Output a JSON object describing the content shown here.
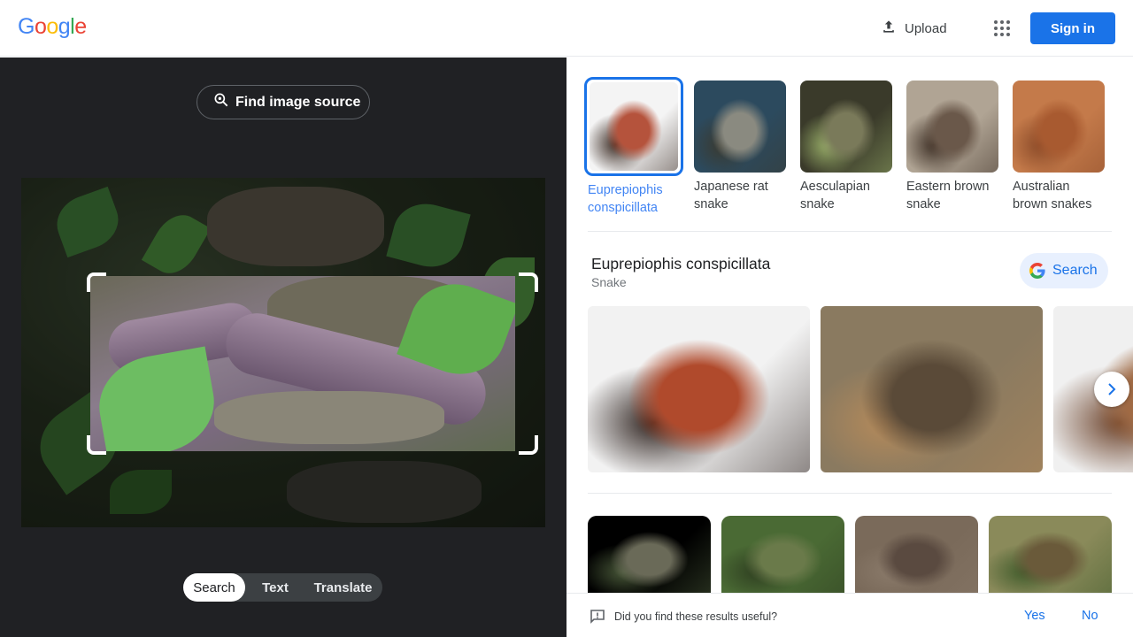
{
  "header": {
    "logo_letters": [
      {
        "ch": "G",
        "color": "#4285F4"
      },
      {
        "ch": "o",
        "color": "#EA4335"
      },
      {
        "ch": "o",
        "color": "#FBBC05"
      },
      {
        "ch": "g",
        "color": "#4285F4"
      },
      {
        "ch": "l",
        "color": "#34A853"
      },
      {
        "ch": "e",
        "color": "#EA4335"
      }
    ],
    "upload_label": "Upload",
    "apps_icon": "grid-apps-icon",
    "signin_label": "Sign in",
    "accent": "#1a73e8"
  },
  "left": {
    "find_source_label": "Find image source",
    "modes": [
      {
        "label": "Search",
        "active": true
      },
      {
        "label": "Text",
        "active": false
      },
      {
        "label": "Translate",
        "active": false
      }
    ]
  },
  "right": {
    "candidates": [
      {
        "label": "Euprepiophis conspicillata",
        "selected": true,
        "colors": [
          "#f4f4f4",
          "#b5533c",
          "#3a2a22"
        ]
      },
      {
        "label": "Japanese rat snake",
        "selected": false,
        "colors": [
          "#2c4a5e",
          "#8a8a80",
          "#3a3a30"
        ]
      },
      {
        "label": "Aesculapian snake",
        "selected": false,
        "colors": [
          "#3a3a2a",
          "#7a7a5a",
          "#9ab06a"
        ]
      },
      {
        "label": "Eastern brown snake",
        "selected": false,
        "colors": [
          "#b0a494",
          "#6a584a",
          "#3c2e24"
        ]
      },
      {
        "label": "Australian brown snakes",
        "selected": false,
        "colors": [
          "#c47a4a",
          "#a85a30",
          "#8a4a28"
        ]
      }
    ],
    "entity": {
      "title": "Euprepiophis conspicillata",
      "subtitle": "Snake",
      "search_label": "Search"
    },
    "gallery_colors": [
      [
        "#f2f2f2",
        "#b04a2c",
        "#2a1e1a"
      ],
      [
        "#8a7a60",
        "#5a4a38",
        "#b58a5a"
      ],
      [
        "#f0f0f0",
        "#a06a44",
        "#6a4028"
      ]
    ],
    "results_colors": [
      [
        "#000000",
        "#6a6a58",
        "#4a5a3a"
      ],
      [
        "#4a6a34",
        "#6a7a4a",
        "#2e3e20"
      ],
      [
        "#7a6a5a",
        "#5a4a40",
        "#8a7a6a"
      ],
      [
        "#8a8a5a",
        "#6a5a3a",
        "#3e5a2a"
      ]
    ],
    "feedback": {
      "question": "Did you find these results useful?",
      "yes": "Yes",
      "no": "No"
    }
  }
}
